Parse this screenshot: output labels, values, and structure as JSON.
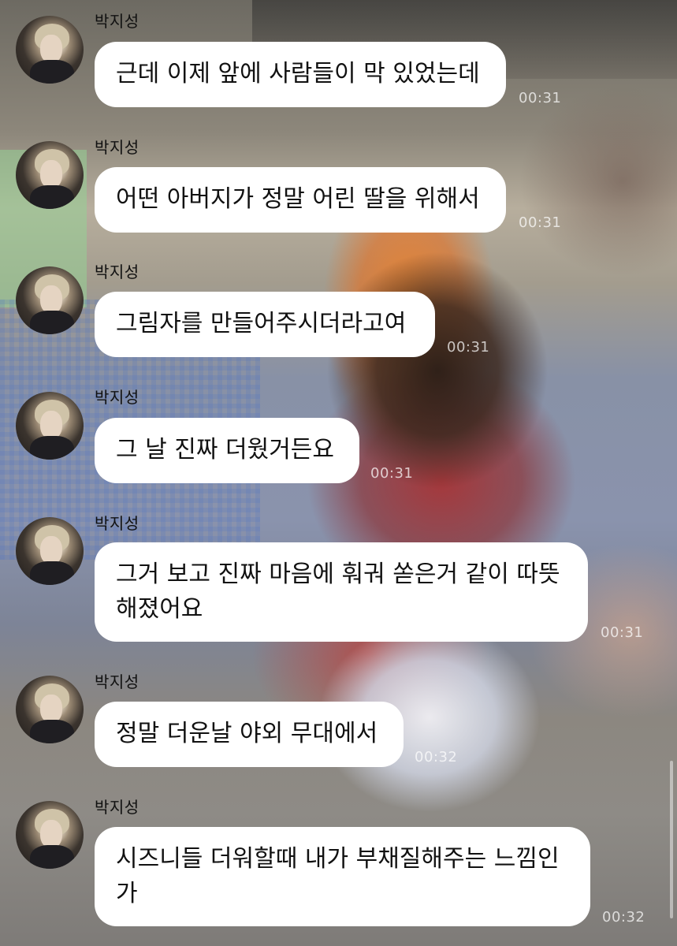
{
  "messages": [
    {
      "sender": "박지성",
      "text": "근데 이제 앞에 사람들이 막 있었는데",
      "time": "00:31"
    },
    {
      "sender": "박지성",
      "text": "어떤 아버지가 정말 어린 딸을 위해서",
      "time": "00:31"
    },
    {
      "sender": "박지성",
      "text": "그림자를 만들어주시더라고여",
      "time": "00:31"
    },
    {
      "sender": "박지성",
      "text": "그 날 진짜 더웠거든요",
      "time": "00:31"
    },
    {
      "sender": "박지성",
      "text": "그거 보고 진짜 마음에 훠궈 쏟은거 같이 따뜻\n해졌어요",
      "time": "00:31"
    },
    {
      "sender": "박지성",
      "text": "정말 더운날 야외 무대에서",
      "time": "00:32"
    },
    {
      "sender": "박지성",
      "text": "시즈니들 더워할때 내가 부채질해주는 느낌인\n가",
      "time": "00:32"
    }
  ],
  "avatar_icon": "profile-photo"
}
